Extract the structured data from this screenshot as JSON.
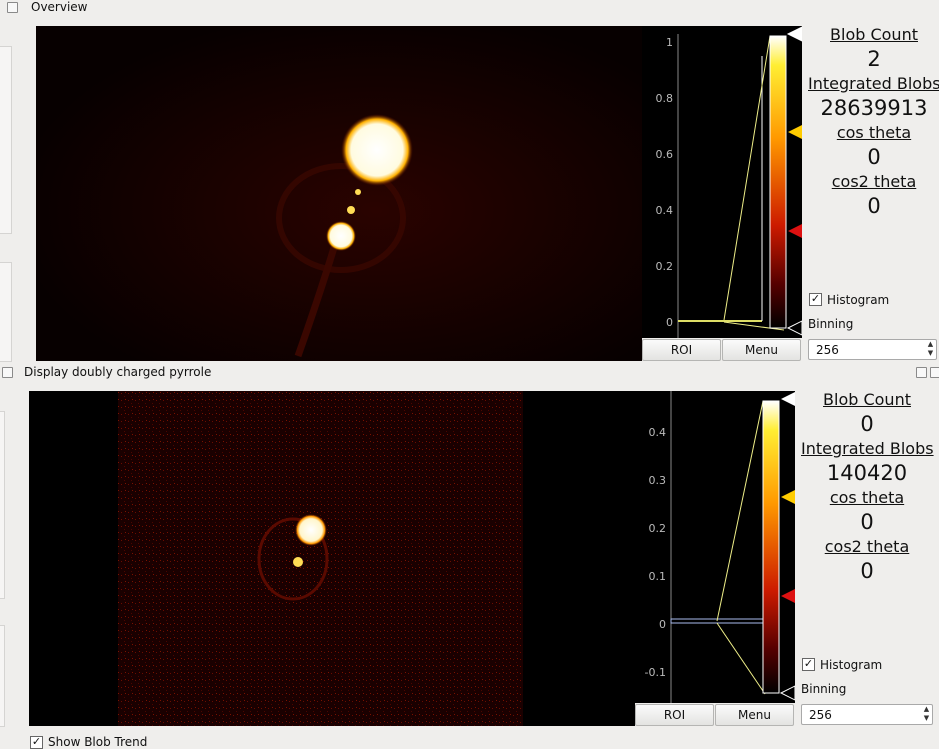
{
  "panels": [
    {
      "title": "Overview",
      "image_colors": {
        "background": "#0b0000",
        "glow": "#3a0600",
        "hot": "#ffffff"
      },
      "axis_ticks": [
        "1",
        "0.8",
        "0.6",
        "0.4",
        "0.2",
        "0"
      ],
      "buttons": {
        "roi": "ROI",
        "menu": "Menu"
      },
      "stats": {
        "blob_count_label": "Blob Count",
        "blob_count": "2",
        "integrated_label": "Integrated Blobs",
        "integrated": "28639913",
        "cos_label": "cos theta",
        "cos": "0",
        "cos2_label": "cos2 theta",
        "cos2": "0"
      },
      "histogram_label": "Histogram",
      "histogram_checked": "✓",
      "binning_label": "Binning",
      "binning_value": "256"
    },
    {
      "title": "Display doubly charged pyrrole",
      "image_colors": {
        "background": "#120000",
        "noise": "#5a0a00",
        "hot": "#ffffff"
      },
      "axis_ticks": [
        "0.4",
        "0.3",
        "0.2",
        "0.1",
        "0",
        "-0.1"
      ],
      "buttons": {
        "roi": "ROI",
        "menu": "Menu"
      },
      "stats": {
        "blob_count_label": "Blob Count",
        "blob_count": "0",
        "integrated_label": "Integrated Blobs",
        "integrated": "140420",
        "cos_label": "cos theta",
        "cos": "0",
        "cos2_label": "cos2 theta",
        "cos2": "0"
      },
      "histogram_label": "Histogram",
      "histogram_checked": "✓",
      "binning_label": "Binning",
      "binning_value": "256"
    }
  ],
  "footer_checkbox_label": "Show Blob Trend",
  "gradient_colors": [
    "#ffffff",
    "#ffee33",
    "#ff9900",
    "#cc1a00",
    "#550000",
    "#000000"
  ]
}
